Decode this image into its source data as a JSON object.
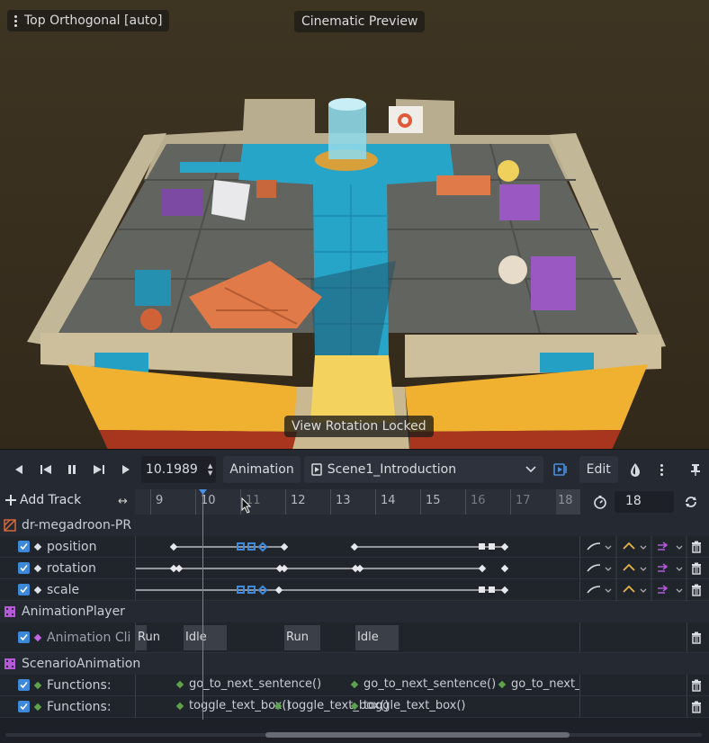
{
  "viewport": {
    "view_mode": "Top Orthogonal [auto]",
    "preview_label": "Cinematic Preview",
    "locked_label": "View Rotation Locked"
  },
  "toolbar": {
    "time_value": "10.1989",
    "animation_button": "Animation",
    "animation_name": "Scene1_Introduction",
    "edit_button": "Edit",
    "icons": [
      "play-backwards-icon",
      "prev-keyframe-icon",
      "pause-icon",
      "next-keyframe-icon",
      "play-icon",
      "autoplay-icon",
      "onion-skin-icon",
      "more-icon",
      "pin-icon"
    ]
  },
  "tracks_header": {
    "add_track": "Add Track",
    "ruler_ticks": [
      "9",
      "10",
      "11",
      "12",
      "13",
      "14",
      "15",
      "16",
      "17",
      "18"
    ],
    "length_value": "18"
  },
  "tracks": {
    "node1": "dr-megadroon-PR",
    "position": "position",
    "rotation": "rotation",
    "scale": "scale",
    "node2": "AnimationPlayer",
    "anim_clips": "Animation Cli",
    "clip_labels": [
      "Run",
      "Idle",
      "Run",
      "Idle"
    ],
    "node3": "ScenarioAnimation",
    "functions1": "Functions:",
    "functions2": "Functions:",
    "func_keys_1": [
      "go_to_next_sentence()",
      "go_to_next_sentence()",
      "go_to_next_"
    ],
    "func_keys_2": [
      "toggle_text_box()",
      "toggle_text_box()",
      "toggle_text_box()"
    ]
  },
  "colors": {
    "accent": "#4a90e2",
    "group_icon_orange": "#e06d3b",
    "group_icon_purple": "#b45ad8",
    "ease_yellow": "#e8b64b",
    "loop_purple": "#b45ad8"
  }
}
